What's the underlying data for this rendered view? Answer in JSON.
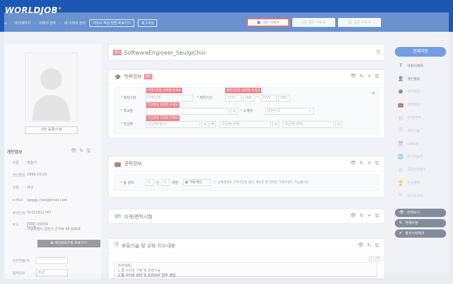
{
  "header": {
    "logo": "WORLDJOB",
    "logo_mark": "+",
    "breadcrumb": [
      "마이페이지",
      "이력서 관리",
      "내 이력서 관리"
    ],
    "guide_btn": "이력서 작성 방법 바로가기",
    "logout_btn": "로그아웃"
  },
  "tabs": [
    "국문 이력서",
    "영문 이력서",
    "일문 이력서"
  ],
  "profile": {
    "photo_btn": "사진 등록/수정",
    "section_title": "개인정보",
    "labels": {
      "name": "이름",
      "birth": "생년월일",
      "gender": "성별",
      "email": "e-Mail",
      "phone": "휴대전화",
      "address": "주소"
    },
    "name": "최슬기",
    "birth": "1996-03-15",
    "gender": "여성",
    "email": "sgggg.choi@gmail.com",
    "phone": "01022612747",
    "address_badge": "국내",
    "zipcode": "05009",
    "address": "서울특별시 광진구 군자로 46,608호",
    "edit_btn": "개인정보수정 바로가기",
    "extra_label1": "희망연봉/처",
    "extra_label2": "병역여부",
    "extra_value2": "무관"
  },
  "resume": {
    "required": "필수",
    "title": "SoftwareEngineer_SeulgiChoi"
  },
  "education": {
    "title": "학력정보",
    "required": "필수",
    "label_type": "학력구분",
    "type_value": "학력선택",
    "label_period": "재학기간",
    "period_y1": "YYYY",
    "period_m1": "MM",
    "period_sep": "~",
    "period_y2": "YYYY",
    "period_m2": "MM",
    "label_school": "학교명",
    "label_location": "소재지",
    "location_value": "대한민국",
    "label_major": "전공명",
    "major1": "전공명(필수)",
    "major2": "전공명(선택)",
    "major3": "전공명(선택)",
    "tip_type": "학력구분을 선택해 주세요",
    "tip_period": "재학기간을 입력해 주세요",
    "tip_school": "학교명을 입력해 주세요",
    "tip_major": "전공명을 입력해 주세요"
  },
  "career": {
    "title": "경력정보",
    "label_total": "총 경력",
    "years": "0",
    "years_unit": "년",
    "months": "0",
    "months_unit": "개월",
    "auto_btn": "자동계산",
    "note": "상세경력의 근무기간을 합산, 계산된 총 경력은 직접수정도 가능합니다."
  },
  "license": {
    "title": "자격/면허시험"
  },
  "skills": {
    "title": "보유기술 및 교육 이수내용",
    "example_head": "작성예제)",
    "example_1": "1.웹 사이트 기획 및 운영가능",
    "example_2": "2.웹 사이트 관리 및 유지보수 업무 경험"
  },
  "sidebar": {
    "save_all": "전체저장",
    "items": [
      "이력서제목",
      "개인정보",
      "학력정보",
      "경력정보",
      "자격/면허",
      "보유기술",
      "OA능력",
      "외국어능력",
      "공인어학점수",
      "수상경력",
      "자기소개서"
    ],
    "view_all": "전체보기",
    "edit_all": "전체수정",
    "check_required": "필수누락체크"
  }
}
